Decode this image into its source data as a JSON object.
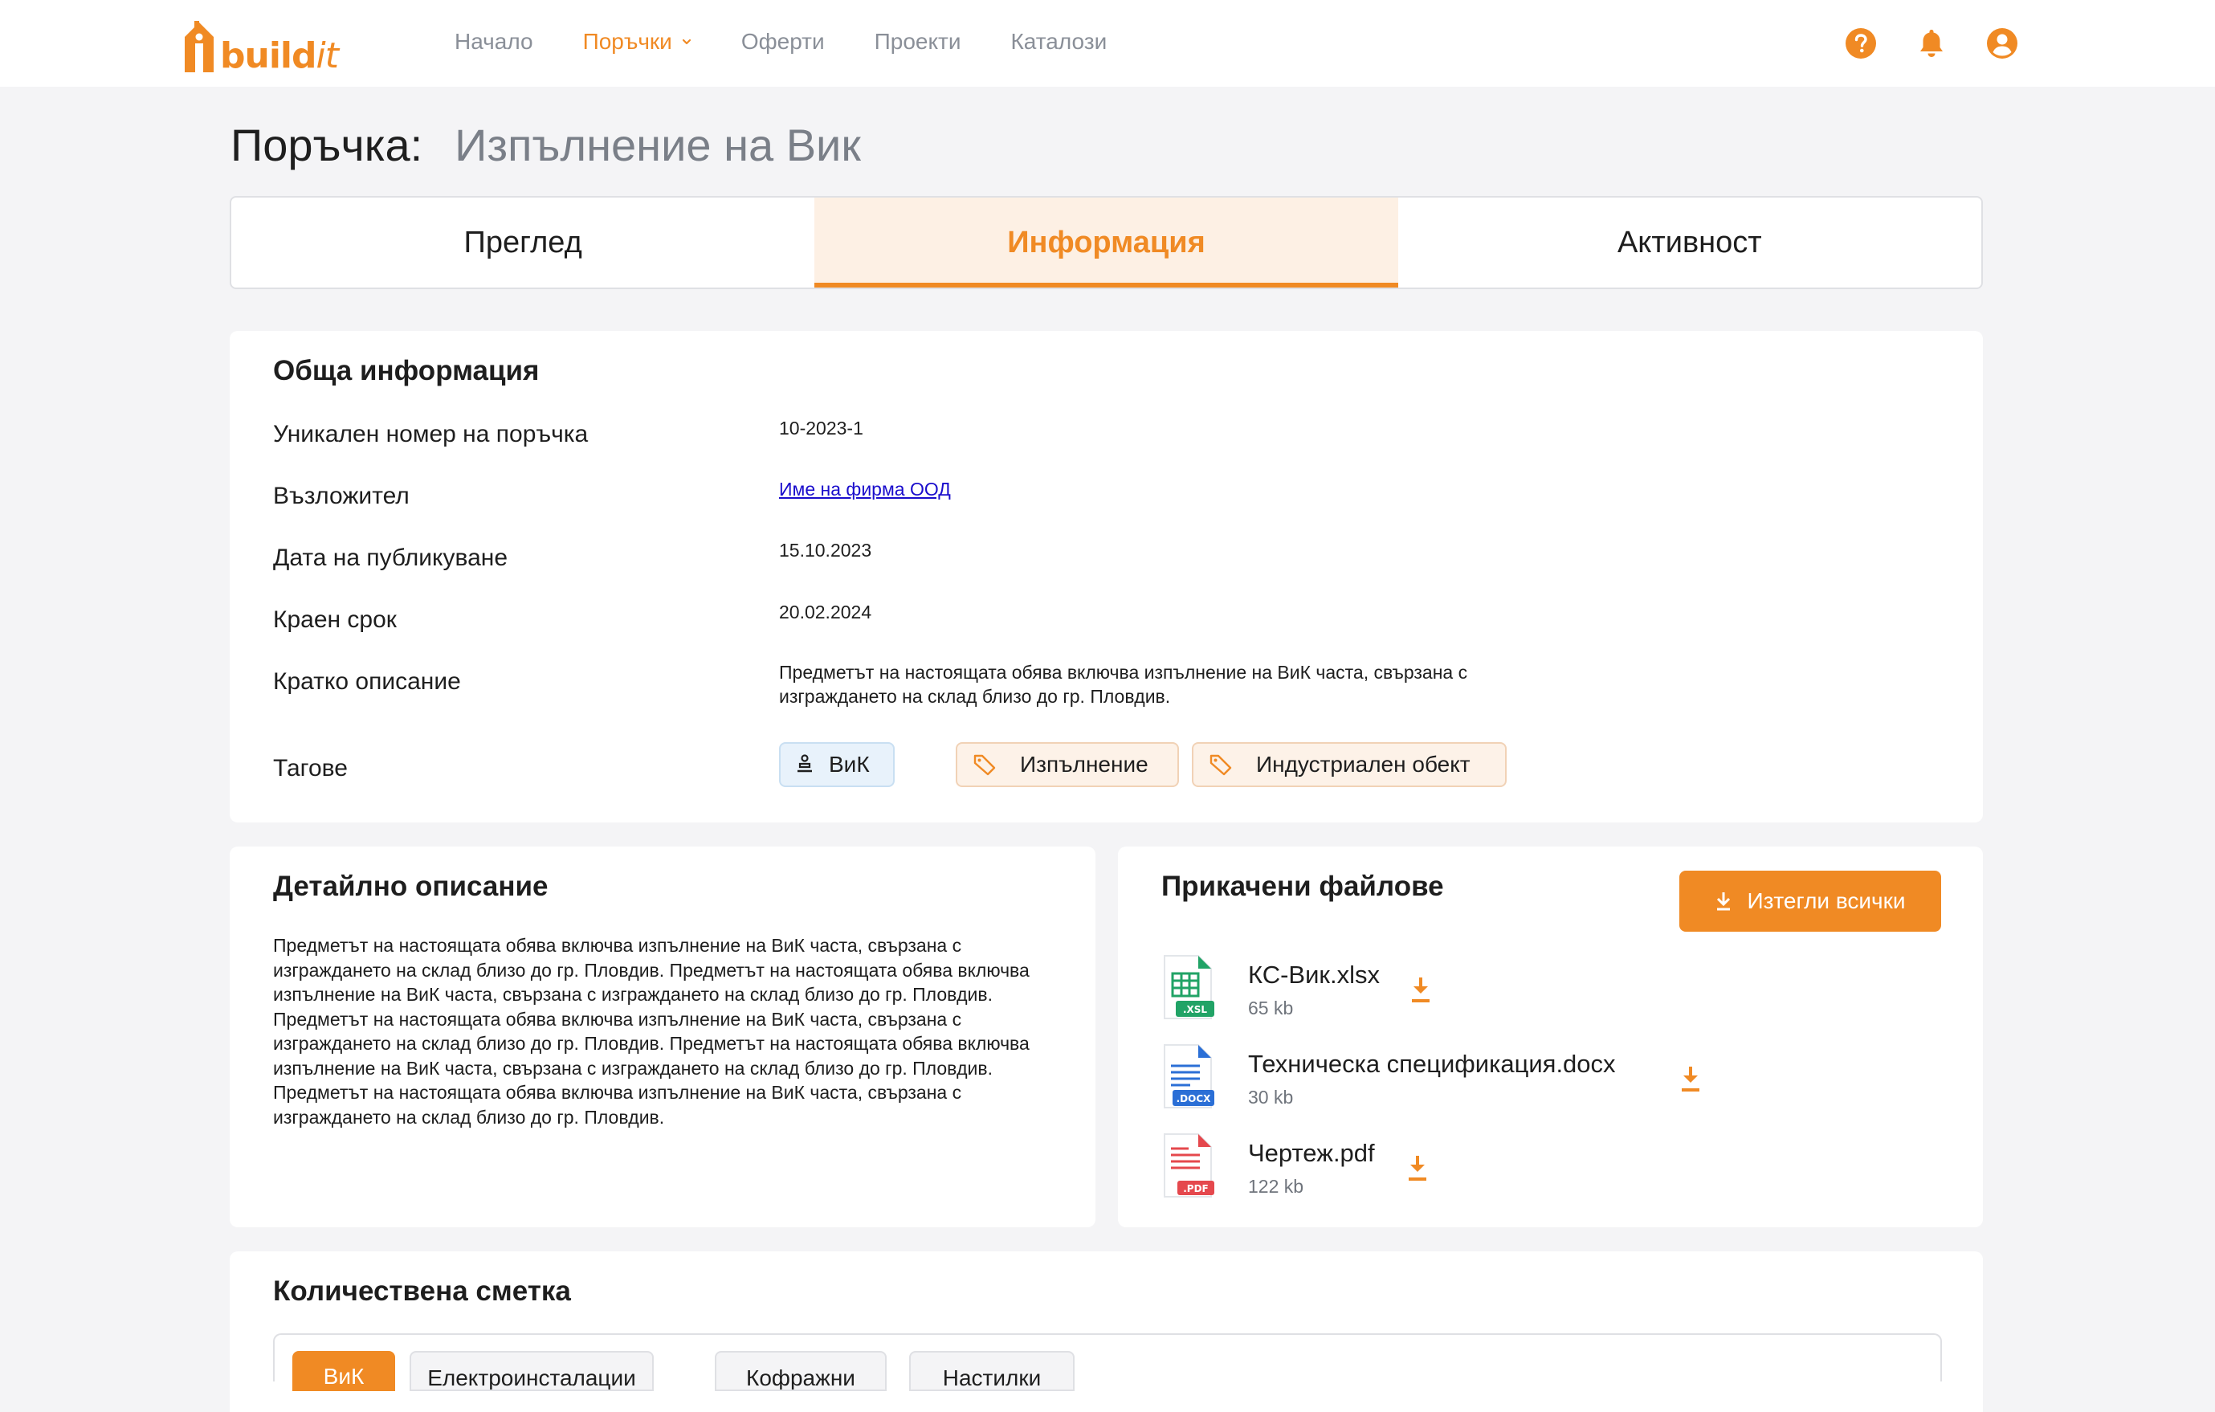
{
  "header": {
    "logo_text_main": "build",
    "logo_text_it": "it",
    "nav": [
      {
        "label": "Начало",
        "active": false
      },
      {
        "label": "Поръчки",
        "active": true,
        "has_dropdown": true
      },
      {
        "label": "Оферти",
        "active": false
      },
      {
        "label": "Проекти",
        "active": false
      },
      {
        "label": "Каталози",
        "active": false
      }
    ],
    "icons": [
      "help-icon",
      "bell-icon",
      "user-icon"
    ],
    "accent_color": "#f08a24"
  },
  "page": {
    "title_label": "Поръчка:",
    "title_value": "Изпълнение на Вик"
  },
  "tabs": [
    {
      "label": "Преглед",
      "active": false
    },
    {
      "label": "Информация",
      "active": true
    },
    {
      "label": "Активност",
      "active": false
    }
  ],
  "general": {
    "heading": "Обща информация",
    "rows": [
      {
        "label": "Уникален номер на поръчка",
        "value": "10-2023-1"
      },
      {
        "label": "Възложител",
        "value": "Име на фирма ООД",
        "link": true
      },
      {
        "label": "Дата на публикуване",
        "value": "15.10.2023"
      },
      {
        "label": "Краен срок",
        "value": "20.02.2024"
      },
      {
        "label": "Кратко описание",
        "value": "Предметът на настоящата обява включва изпълнение на ВиК часта, свързана с изграждането на склад близо до гр. Пловдив."
      }
    ],
    "tags_label": "Тагове",
    "tags": [
      {
        "label": "ВиК",
        "style": "blue",
        "icon": "plumbing-icon"
      },
      {
        "label": "Изпълнение",
        "style": "orange",
        "icon": "tag-icon"
      },
      {
        "label": "Индустриален обект",
        "style": "orange",
        "icon": "tag-icon"
      }
    ]
  },
  "details": {
    "heading": "Детайлно описание",
    "text": "Предметът на настоящата обява включва изпълнение на ВиК часта, свързана с изграждането на склад близо до гр. Пловдив. Предметът на настоящата обява включва изпълнение на ВиК часта, свързана с изграждането на склад близо до гр. Пловдив. Предметът на настоящата обява включва изпълнение на ВиК часта, свързана с изграждането на склад близо до гр. Пловдив. Предметът на настоящата обява включва изпълнение на ВиК часта, свързана с изграждането на склад близо до гр. Пловдив. Предметът на настоящата обява включва изпълнение на ВиК часта, свързана с изграждането на склад близо до гр. Пловдив."
  },
  "files": {
    "heading": "Прикачени файлове",
    "download_all_label": "Изтегли всички",
    "items": [
      {
        "name": "КС-Вик.xlsx",
        "size": "65 kb",
        "badge": ".XSL",
        "type": "xlsx",
        "color": "#21a366"
      },
      {
        "name": "Техническа спецификация.docx",
        "size": "30 kb",
        "badge": ".DOCX",
        "type": "docx",
        "color": "#2b6fd6"
      },
      {
        "name": "Чертеж.pdf",
        "size": "122 kb",
        "badge": ".PDF",
        "type": "pdf",
        "color": "#e5484d"
      }
    ]
  },
  "quantity": {
    "heading": "Количествена сметка",
    "tabs": [
      {
        "label": "ВиК",
        "active": true
      },
      {
        "label": "Електроинсталации",
        "active": false
      },
      {
        "label": "Кофражни",
        "active": false
      },
      {
        "label": "Настилки",
        "active": false
      }
    ]
  }
}
